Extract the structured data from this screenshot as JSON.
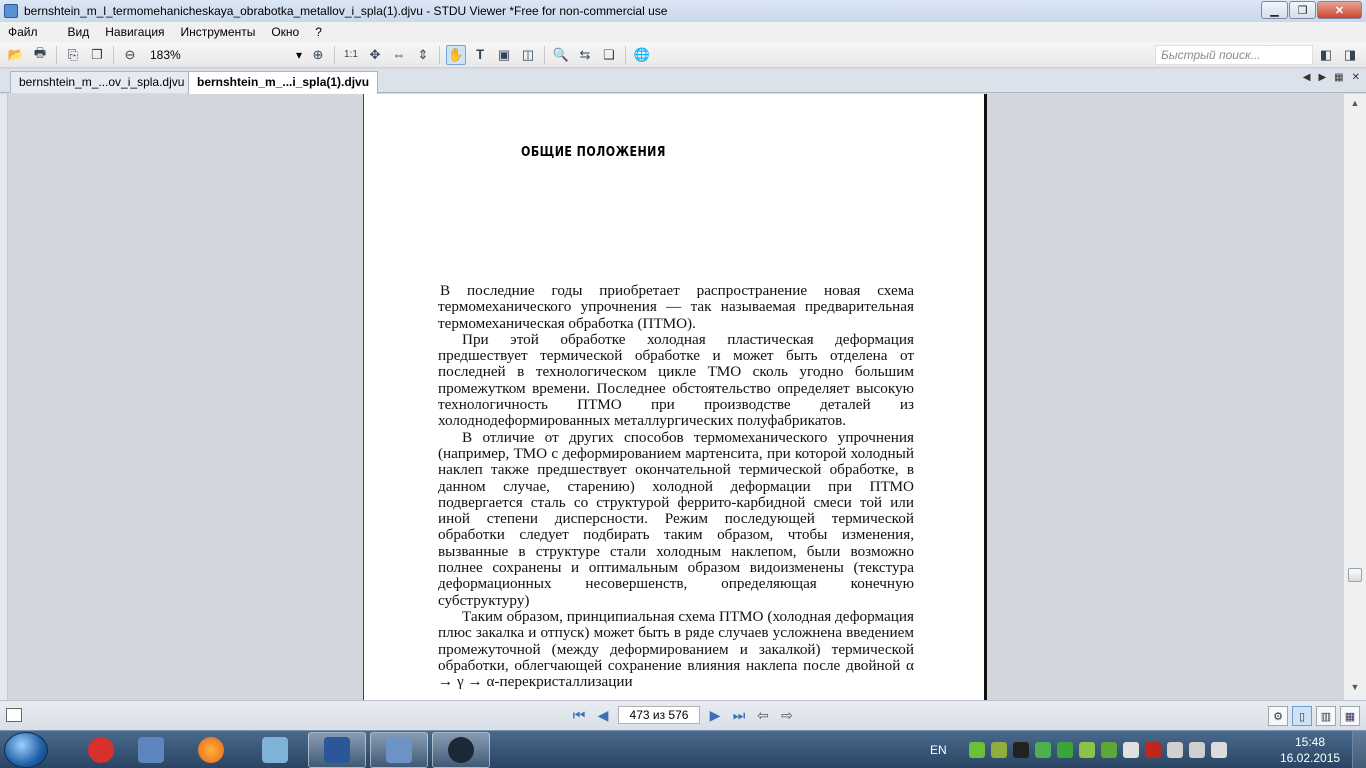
{
  "window": {
    "title": "bernshtein_m_l_termomehanicheskaya_obrabotka_metallov_i_spla(1).djvu - STDU Viewer *Free for non-commercial use",
    "minimize_symbol": "▁",
    "maximize_symbol": "❐",
    "close_symbol": "✕"
  },
  "menu": {
    "items": [
      "Файл",
      "Вид",
      "Навигация",
      "Инструменты",
      "Окно",
      "?"
    ]
  },
  "toolbar": {
    "zoom_value": "183%",
    "zoom_dropdown_symbol": "▾",
    "actual_size_label": "1:1",
    "search_placeholder": "Быстрый поиск..."
  },
  "tabs": [
    {
      "label": "bernshtein_m_...ov_i_spla.djvu",
      "active": false
    },
    {
      "label": "bernshtein_m_...i_spla(1).djvu",
      "active": true
    }
  ],
  "tab_controls": {
    "prev": "◀",
    "next": "▶",
    "tile": "▦",
    "close": "✕"
  },
  "document": {
    "heading": "ОБЩИЕ ПОЛОЖЕНИЯ",
    "paragraphs": [
      "В последние годы приобретает распространение новая схема термомеханического упрочнения — так называемая предварительная термомеханическая обработка (ПТМО).",
      "При этой обработке холодная пластическая деформация предшествует термической обработке и может быть отделена от последней в технологическом цикле ТМО сколь угодно большим промежутком времени. Последнее обстоятельство определяет высокую технологичность ПТМО при производстве деталей из холоднодеформированных металлургических полуфабрикатов.",
      "В отличие от других способов термомеханического упрочнения (например, ТМО с деформированием мартенсита, при которой холодный наклеп также предшествует окончательной термической обработке, в данном случае, старению) холодной деформации при ПТМО подвергается сталь со структурой феррито-карбидной смеси той или иной степени дисперсности. Режим последующей термической обработки следует подбирать таким образом, чтобы изменения, вызванные в структуре стали холодным наклепом, были возможно полнее сохранены и оптимальным образом видоизменены (текстура деформационных несовершенств, определяющая конечную субструктуру)",
      "Таким образом, принципиальная схема ПТМО (холодная деформация плюс закалка и отпуск) может быть в ряде случаев усложнена введением промежуточной (между деформированием и закалкой) термической обработки, облегчающей сохранение влияния наклепа после двойной α → γ → α-перекристаллизации"
    ]
  },
  "statusbar": {
    "page_indicator": "473 из 576"
  },
  "taskbar": {
    "language": "EN",
    "time": "15:48",
    "date": "16.02.2015"
  },
  "colors": {
    "accent": "#3b6fb6",
    "titlebar": "#c9d8ec",
    "close_button": "#c9452f",
    "taskbar": "#2a4563"
  }
}
